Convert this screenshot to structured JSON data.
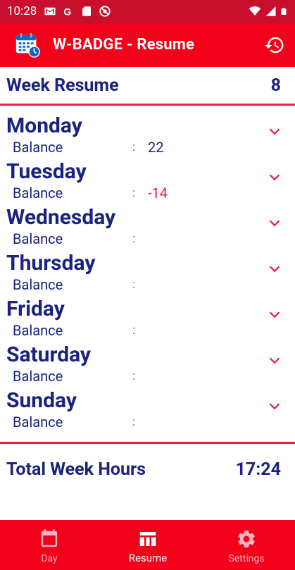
{
  "status_bar": {
    "time": "10:28",
    "left_icons": [
      "gmail-icon",
      "google-icon",
      "sd-card-icon",
      "no-disturb-icon"
    ],
    "right_icons": [
      "wifi-icon",
      "signal-icon",
      "battery-icon"
    ]
  },
  "app_bar": {
    "title": "W-BADGE - Resume",
    "logo_icon": "calendar-clock-icon",
    "action_icon": "history-icon"
  },
  "week": {
    "title": "Week Resume",
    "number": "8"
  },
  "balance_label": "Balance",
  "colon": ":",
  "days": [
    {
      "name": "Monday",
      "balance": "22"
    },
    {
      "name": "Tuesday",
      "balance": "-14"
    },
    {
      "name": "Wednesday",
      "balance": ""
    },
    {
      "name": "Thursday",
      "balance": ""
    },
    {
      "name": "Friday",
      "balance": ""
    },
    {
      "name": "Saturday",
      "balance": ""
    },
    {
      "name": "Sunday",
      "balance": ""
    }
  ],
  "total": {
    "label": "Total Week Hours",
    "value": "17:24"
  },
  "bottom_nav": {
    "items": [
      {
        "label": "Day",
        "icon": "calendar-icon",
        "active": false
      },
      {
        "label": "Resume",
        "icon": "table-icon",
        "active": true
      },
      {
        "label": "Settings",
        "icon": "gear-icon",
        "active": false
      }
    ]
  },
  "colors": {
    "primary_red": "#f3001a",
    "status_red": "#c8102e",
    "navy": "#1a237e",
    "accent_red": "#e8213a"
  }
}
